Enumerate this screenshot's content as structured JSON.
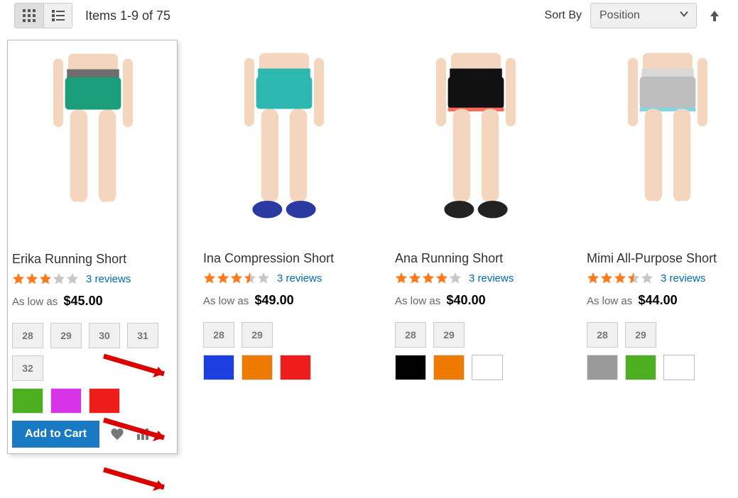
{
  "toolbar": {
    "count_text": "Items 1-9 of 75",
    "sort_label": "Sort By",
    "sort_selected": "Position"
  },
  "products": [
    {
      "name": "Erika Running Short",
      "rating": 3.0,
      "reviews_text": "3 reviews",
      "price_prefix": "As low as",
      "price": "$45.00",
      "sizes": [
        "28",
        "29",
        "30",
        "31",
        "32"
      ],
      "colors": [
        "#4caf1f",
        "#d733e8",
        "#ef1c1c"
      ],
      "style": {
        "short": "#1a9e7a",
        "waist": "#6e6e6e",
        "shoe": "#ffffff"
      },
      "hovered": true
    },
    {
      "name": "Ina Compression Short",
      "rating": 3.5,
      "reviews_text": "3 reviews",
      "price_prefix": "As low as",
      "price": "$49.00",
      "sizes": [
        "28",
        "29"
      ],
      "colors": [
        "#1b3fe0",
        "#ef7a00",
        "#ef1c1c"
      ],
      "style": {
        "short": "#2cb8b0",
        "waist": "#2cb8b0",
        "shoe": "#2b3aa0"
      },
      "hovered": false
    },
    {
      "name": "Ana Running Short",
      "rating": 4.0,
      "reviews_text": "3 reviews",
      "price_prefix": "As low as",
      "price": "$40.00",
      "sizes": [
        "28",
        "29"
      ],
      "colors": [
        "#000000",
        "#ef7a00",
        "#ffffff"
      ],
      "style": {
        "short": "#111111",
        "waist": "#111111",
        "trim": "#ff6a5a",
        "shoe": "#222222"
      },
      "hovered": false
    },
    {
      "name": "Mimi All-Purpose Short",
      "rating": 3.5,
      "reviews_text": "3 reviews",
      "price_prefix": "As low as",
      "price": "$44.00",
      "sizes": [
        "28",
        "29"
      ],
      "colors": [
        "#9a9a9a",
        "#4caf1f",
        "#ffffff"
      ],
      "style": {
        "short": "#bdbdbd",
        "waist": "#d9d9d9",
        "trim": "#7fd7e0",
        "shoe": "#ffffff"
      },
      "hovered": false
    }
  ],
  "actions": {
    "add_to_cart": "Add to Cart"
  }
}
